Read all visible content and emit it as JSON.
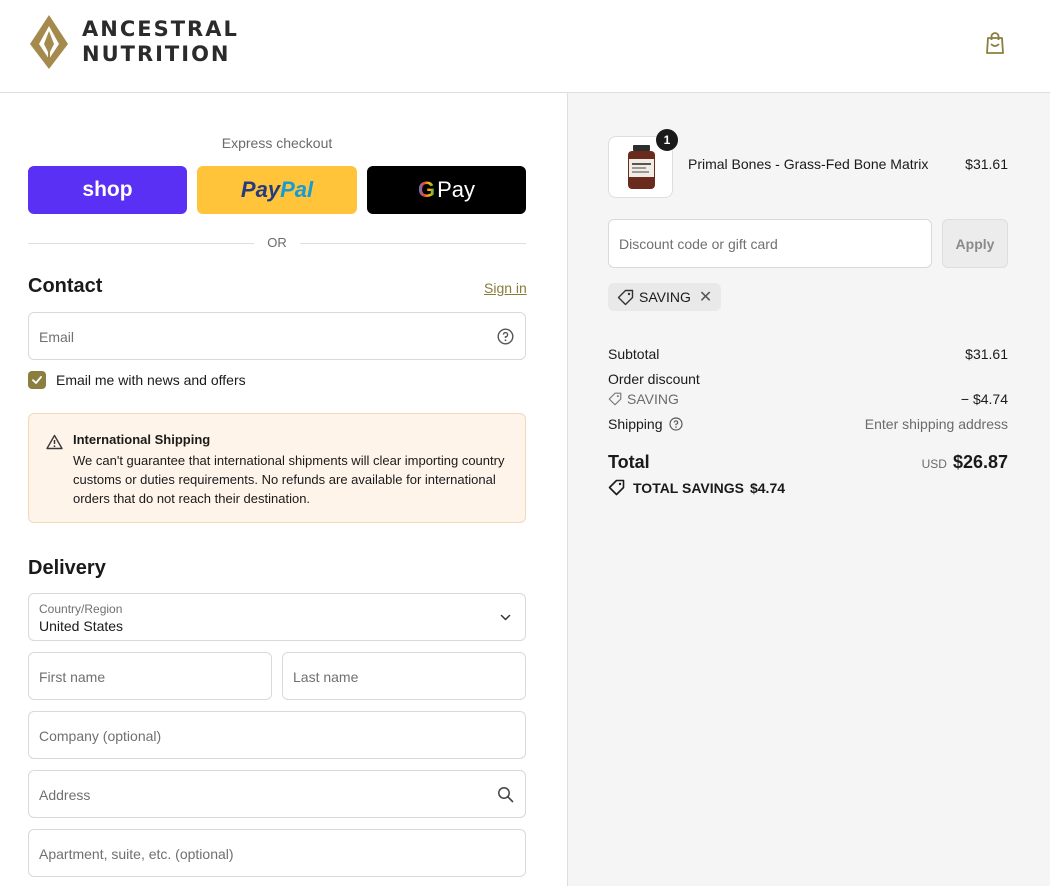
{
  "brand": {
    "line1": "ANCESTRAL",
    "line2": "NUTRITION"
  },
  "header": {
    "cart_icon": "shopping-bag-icon"
  },
  "express": {
    "title": "Express checkout",
    "shop_label": "shop",
    "paypal_part1": "Pay",
    "paypal_part2": "Pal",
    "gpay_g": "G",
    "gpay_label": "Pay",
    "or_label": "OR"
  },
  "contact": {
    "title": "Contact",
    "signin_label": "Sign in",
    "email_placeholder": "Email",
    "newsletter_label": "Email me with news and offers",
    "newsletter_checked": true
  },
  "notice": {
    "title": "International Shipping",
    "body": "We can't guarantee that international shipments will clear importing country customs or duties requirements. No refunds are available for international orders that do not reach their destination."
  },
  "delivery": {
    "title": "Delivery",
    "country_label": "Country/Region",
    "country_value": "United States",
    "first_name_placeholder": "First name",
    "last_name_placeholder": "Last name",
    "company_placeholder": "Company (optional)",
    "address_placeholder": "Address",
    "apartment_placeholder": "Apartment, suite, etc. (optional)"
  },
  "summary": {
    "product": {
      "name": "Primal Bones - Grass-Fed Bone Matrix",
      "price": "$31.61",
      "quantity": "1"
    },
    "discount_placeholder": "Discount code or gift card",
    "apply_label": "Apply",
    "applied_code": "SAVING",
    "subtotal_label": "Subtotal",
    "subtotal_value": "$31.61",
    "order_discount_label": "Order discount",
    "discount_code": "SAVING",
    "discount_value": "− $4.74",
    "shipping_label": "Shipping",
    "shipping_value": "Enter shipping address",
    "total_label": "Total",
    "currency": "USD",
    "total_value": "$26.87",
    "savings_label": "TOTAL SAVINGS",
    "savings_value": "$4.74"
  },
  "colors": {
    "shop": "#5a31f4",
    "paypal": "#ffc439",
    "gpay": "#000000",
    "accent": "#8a7f3f"
  }
}
